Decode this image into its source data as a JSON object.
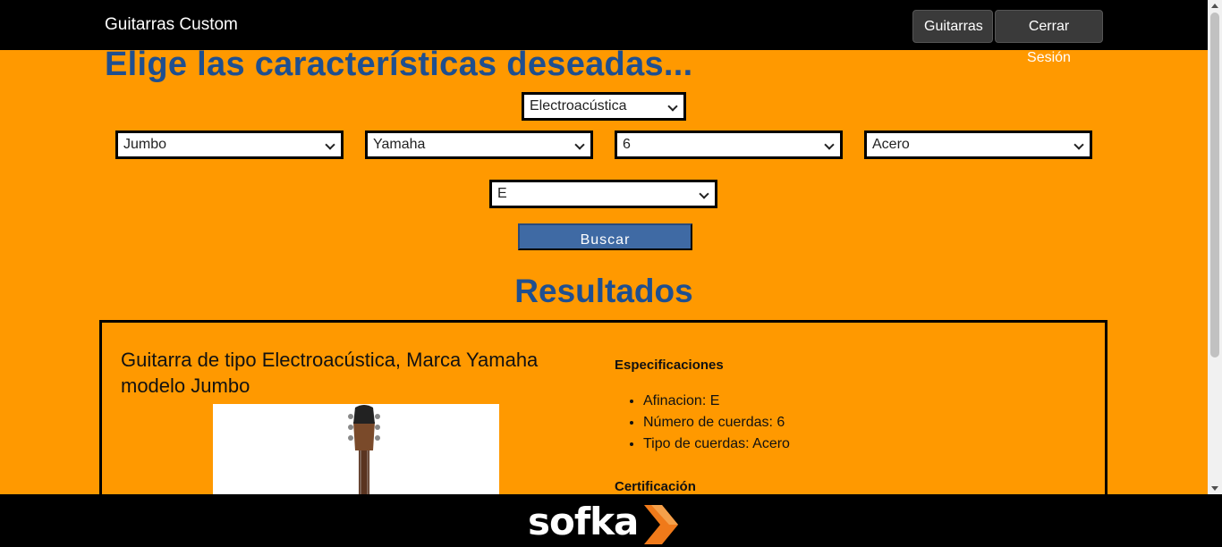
{
  "nav": {
    "brand": "Guitarras Custom",
    "guitarras_label": "Guitarras",
    "logout_label": "Cerrar Sesión"
  },
  "filters": {
    "heading": "Elige las características deseadas...",
    "tipo": "Electroacústica",
    "modelo": "Jumbo",
    "marca": "Yamaha",
    "cuerdas_num": "6",
    "cuerdas_tipo": "Acero",
    "afinacion": "E",
    "search_label": "Buscar"
  },
  "results": {
    "heading": "Resultados",
    "card": {
      "title": "Guitarra de tipo Electroacústica, Marca Yamaha modelo Jumbo",
      "specs_heading": "Especificaciones",
      "specs": [
        "Afinacion: E",
        "Número de cuerdas: 6",
        "Tipo de cuerdas: Acero"
      ],
      "cert_heading": "Certificación"
    }
  },
  "footer": {
    "logo_text": "sofka"
  },
  "colors": {
    "background": "#ff9900",
    "heading": "#1f4f8f",
    "button": "#3f6aa4",
    "navbar": "#000000"
  }
}
